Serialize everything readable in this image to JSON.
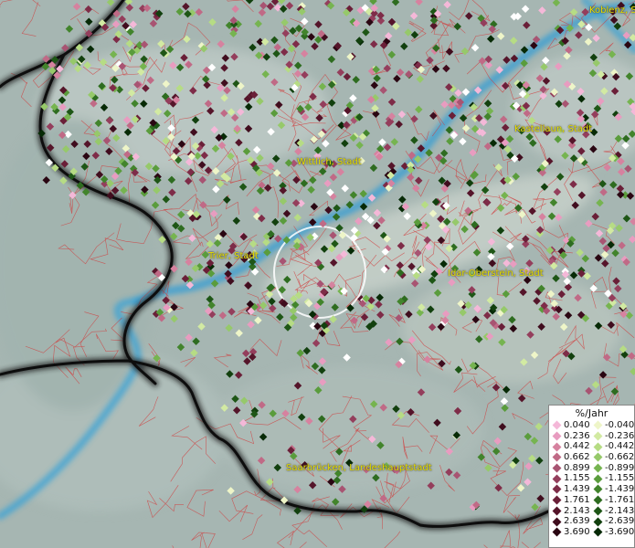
{
  "map": {
    "cities": [
      {
        "id": "koblenz",
        "name": "Koblenz, St"
      },
      {
        "id": "kastellaun",
        "name": "Kastellaun, Stadt"
      },
      {
        "id": "wittlich",
        "name": "Wittlich, Stadt"
      },
      {
        "id": "trier",
        "name": "Trier, Stadt"
      },
      {
        "id": "idar",
        "name": "Idar-Oberstein, Stadt"
      },
      {
        "id": "saarbruecken",
        "name": "Saarbrücken, Landeshauptstadt"
      }
    ],
    "colors": {
      "terrain": "#a9b8b4",
      "river": "#3aa3d6",
      "border": "#111111",
      "municipal_lines": "#d23a3a",
      "highlight": "#ffffff"
    }
  },
  "legend": {
    "title": "%/Jahr",
    "positive": [
      {
        "label": "0.040",
        "color": "#f4b8d8"
      },
      {
        "label": "0.236",
        "color": "#e89cc0"
      },
      {
        "label": "0.442",
        "color": "#d6829f"
      },
      {
        "label": "0.662",
        "color": "#c06a86"
      },
      {
        "label": "0.899",
        "color": "#a85472"
      },
      {
        "label": "1.155",
        "color": "#943e5c"
      },
      {
        "label": "1.439",
        "color": "#7e2c48"
      },
      {
        "label": "1.761",
        "color": "#6a1f38"
      },
      {
        "label": "2.143",
        "color": "#55152a"
      },
      {
        "label": "2.639",
        "color": "#400d1e"
      },
      {
        "label": "3.690",
        "color": "#2a0612"
      }
    ],
    "negative": [
      {
        "label": "-0.040",
        "color": "#eef5c8"
      },
      {
        "label": "-0.236",
        "color": "#d2eaa2"
      },
      {
        "label": "-0.442",
        "color": "#b6dc84"
      },
      {
        "label": "-0.662",
        "color": "#96c96a"
      },
      {
        "label": "-0.899",
        "color": "#76b450"
      },
      {
        "label": "-1.155",
        "color": "#5a9c3c"
      },
      {
        "label": "-1.439",
        "color": "#42842c"
      },
      {
        "label": "-1.761",
        "color": "#2e6c20"
      },
      {
        "label": "-2.143",
        "color": "#1e5616"
      },
      {
        "label": "-2.639",
        "color": "#12400e"
      },
      {
        "label": "-3.690",
        "color": "#072a06"
      }
    ]
  }
}
